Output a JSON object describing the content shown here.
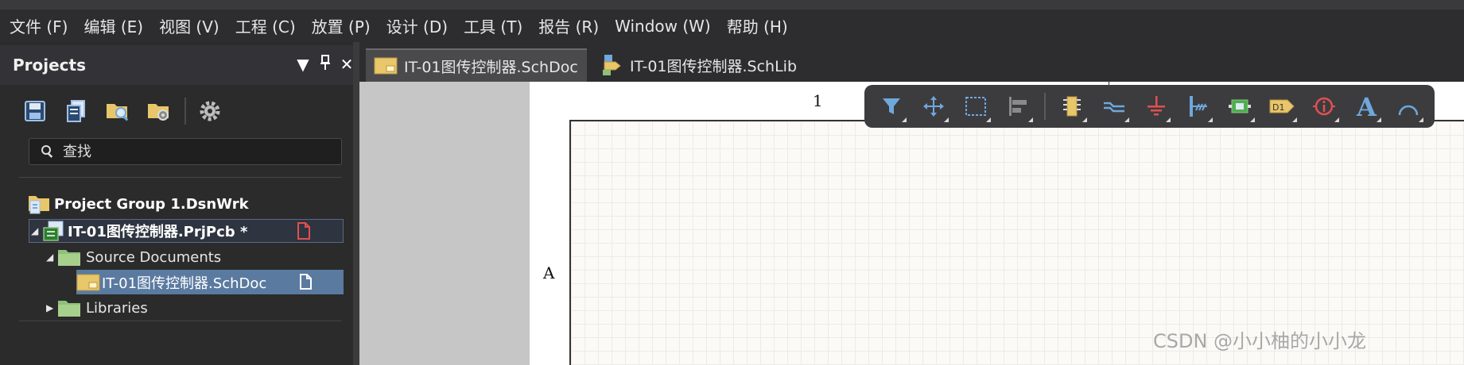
{
  "menu": [
    "文件 (F)",
    "编辑 (E)",
    "视图 (V)",
    "工程 (C)",
    "放置 (P)",
    "设计 (D)",
    "工具 (T)",
    "报告 (R)",
    "Window (W)",
    "帮助 (H)"
  ],
  "panel": {
    "title": "Projects",
    "search_placeholder": "查找",
    "tree": {
      "group": "Project Group 1.DsnWrk",
      "project": "IT-01图传控制器.PrjPcb *",
      "source_folder": "Source Documents",
      "schdoc": "IT-01图传控制器.SchDoc",
      "libraries": "Libraries"
    }
  },
  "tabs": [
    {
      "label": "IT-01图传控制器.SchDoc",
      "active": true
    },
    {
      "label": "IT-01图传控制器.SchLib",
      "active": false
    }
  ],
  "sheet": {
    "zone_col": "1",
    "zone_row": "A"
  },
  "toolbar_icons": [
    "filter-icon",
    "move-icon",
    "select-rect-icon",
    "align-icon",
    "component-icon",
    "wire-icon",
    "ground-icon",
    "bus-icon",
    "port-icon",
    "net-label-icon",
    "directive-icon",
    "text-icon",
    "arc-icon"
  ],
  "watermark": "CSDN @小小柚的小小龙",
  "colors": {
    "accent_blue": "#5a7aa0",
    "icon_blue": "#6fa8dc",
    "icon_red": "#e05050",
    "folder_yellow": "#e8c66a",
    "folder_green": "#8ec07c"
  }
}
